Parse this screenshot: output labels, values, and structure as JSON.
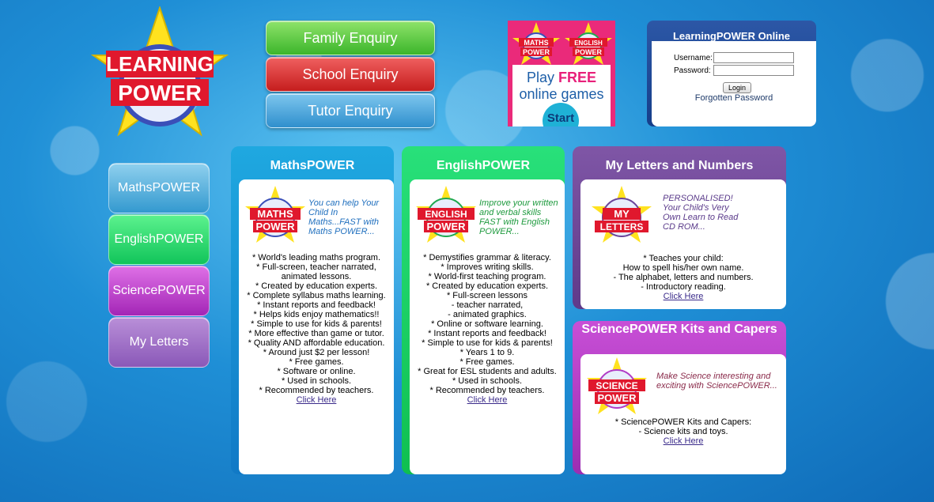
{
  "logo": {
    "line1": "LEARNING",
    "line2": "POWER"
  },
  "enquiries": {
    "family": "Family Enquiry",
    "school": "School Enquiry",
    "tutor": "Tutor Enquiry"
  },
  "games_banner": {
    "badge1": {
      "l1": "MATHS",
      "l2": "POWER"
    },
    "badge2": {
      "l1": "ENGLISH",
      "l2": "POWER"
    },
    "play": "Play",
    "free": "FREE",
    "line2": "online games",
    "start": "Start"
  },
  "login": {
    "title": "LearningPOWER Online",
    "username_label": "Username:",
    "password_label": "Password:",
    "button": "Login",
    "forgot": "Forgotten Password"
  },
  "side_nav": {
    "maths": "MathsPOWER",
    "english": "EnglishPOWER",
    "science": "SciencePOWER",
    "letters": "My Letters"
  },
  "panels": {
    "maths": {
      "title": "MathsPOWER",
      "badge": {
        "l1": "MATHS",
        "l2": "POWER"
      },
      "intro": "You can help Your Child In Maths...FAST with Maths POWER...",
      "items": [
        "* World's leading maths program.",
        "* Full-screen, teacher narrated,",
        "animated lessons.",
        "* Created by education experts.",
        "* Complete syllabus maths learning.",
        "* Instant reports and feedback!",
        "* Helps kids enjoy mathematics!!",
        "* Simple to use for kids & parents!",
        "* More effective than game or tutor.",
        "* Quality AND affordable education.",
        "* Around just $2 per lesson!",
        "* Free games.",
        "* Software or online.",
        "* Used in schools.",
        "* Recommended by teachers."
      ],
      "link": "Click Here"
    },
    "english": {
      "title": "EnglishPOWER",
      "badge": {
        "l1": "ENGLISH",
        "l2": "POWER"
      },
      "intro": "Improve your written and verbal skills FAST with English POWER...",
      "items": [
        "* Demystifies grammar & literacy.",
        "* Improves writing skills.",
        "* World-first teaching program.",
        "* Created by education experts.",
        "* Full-screen lessons",
        "- teacher narrated,",
        "- animated graphics.",
        "* Online or software learning.",
        "* Instant reports and feedback!",
        "* Simple to use for kids & parents!",
        "* Years 1 to 9.",
        "* Free games.",
        "* Great for ESL students and adults.",
        "* Used in schools.",
        "* Recommended by teachers."
      ],
      "link": "Click Here"
    },
    "letters": {
      "title": "My Letters and Numbers",
      "badge": {
        "l1": "MY",
        "l2": "LETTERS"
      },
      "intro": "PERSONALISED! Your Child's Very Own Learn to Read CD ROM...",
      "items": [
        "* Teaches your child:",
        "How to spell his/her own name.",
        "- The alphabet, letters and numbers.",
        "- Introductory reading."
      ],
      "link": "Click Here"
    },
    "science": {
      "title": "SciencePOWER Kits and Capers",
      "badge": {
        "l1": "SCIENCE",
        "l2": "POWER"
      },
      "intro": "Make Science interesting and exciting with SciencePOWER...",
      "items": [
        "* SciencePOWER Kits and Capers:",
        "- Science kits and toys."
      ],
      "link": "Click Here"
    }
  },
  "colors": {
    "maths": "#1fa8e0",
    "english": "#0fbf50",
    "letters": "#6a449a",
    "science": "#b03cc6",
    "star": "#ffe21f",
    "badge_red": "#e0182d"
  }
}
